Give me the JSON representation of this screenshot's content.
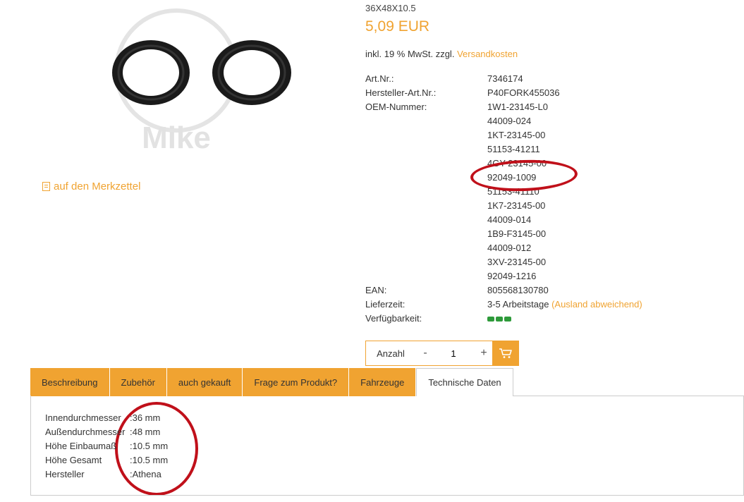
{
  "product": {
    "size_title": "36X48X10.5",
    "price": "5,09 EUR",
    "tax_text": "inkl. 19 % MwSt. zzgl.",
    "shipping_link": "Versandkosten",
    "image_watermark": "Mike"
  },
  "wishlist": {
    "label": "auf den Merkzettel",
    "icon": "notepad-icon"
  },
  "specs": {
    "art_nr_label": "Art.Nr.:",
    "art_nr": "7346174",
    "mfr_label": "Hersteller-Art.Nr.:",
    "mfr": "P40FORK455036",
    "oem_label": "OEM-Nummer:",
    "oem_numbers": [
      "1W1-23145-L0",
      "44009-024",
      "1KT-23145-00",
      "51153-41211",
      "4GY-23145-00",
      "92049-1009",
      "51153-41110",
      "1K7-23145-00",
      "44009-014",
      "1B9-F3145-00",
      "44009-012",
      "3XV-23145-00",
      "92049-1216"
    ],
    "ean_label": "EAN:",
    "ean": "805568130780",
    "delivery_label": "Lieferzeit:",
    "delivery": "3-5 Arbeitstage",
    "delivery_note": "(Ausland abweichend)",
    "avail_label": "Verfügbarkeit:",
    "avail_color": "#2e9a3a"
  },
  "cart": {
    "qty_label": "Anzahl",
    "minus": "-",
    "qty": "1",
    "plus": "+",
    "icon": "cart-icon"
  },
  "tabs": [
    "Beschreibung",
    "Zubehör",
    "auch gekauft",
    "Frage zum Produkt?",
    "Fahrzeuge",
    "Technische Daten"
  ],
  "tech": [
    {
      "label": "Innendurchmesser",
      "value": ":36 mm"
    },
    {
      "label": "Außendurchmesser",
      "value": ":48 mm"
    },
    {
      "label": "Höhe Einbaumaß",
      "value": ":10.5 mm"
    },
    {
      "label": "Höhe Gesamt",
      "value": ":10.5 mm"
    },
    {
      "label": "Hersteller",
      "value": ":Athena"
    }
  ],
  "colors": {
    "accent": "#f0a331",
    "highlight": "#c0101a"
  }
}
